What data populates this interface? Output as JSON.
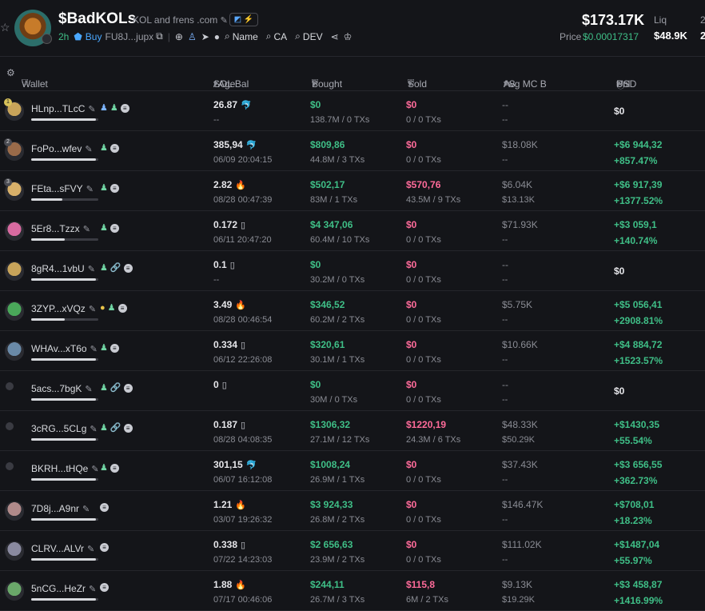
{
  "token": {
    "name": "$BadKOLs",
    "description": "KOL and frens .com",
    "age": "2h",
    "buy_label": "Buy",
    "address": "FU8J...jupx",
    "links": [
      "Name",
      "CA",
      "DEV"
    ],
    "market_cap": "$173.17K",
    "price_label": "Price",
    "price": "$0.00017317",
    "liq_label": "Liq",
    "liq": "$48.9K",
    "next_label": "2",
    "next_val": "2",
    "colors": {
      "positive": "#3fbf87",
      "negative": "#ff6b9a",
      "accent": "#4aa8ff",
      "background": "#141519"
    }
  },
  "columns": {
    "wallet": "Wallet",
    "sol_bal": "SOL Bal",
    "age": "/ Age",
    "bought": "Bought",
    "sold": "Sold",
    "avg_mc": "Avg MC B",
    "avg_mc_s": "/ S",
    "pnl": "Pnl",
    "usd": "USD"
  },
  "rows": [
    {
      "rank": "1",
      "addr": "HLnp...TLcC",
      "sol": "26.87",
      "src": "bonk",
      "date": "--",
      "bought": "$0",
      "bought_sub": "138.7M / 0 TXs",
      "sold": "$0",
      "sold_sub": "0 / 0 TXs",
      "mcb": "--",
      "mcs": "--",
      "pnl": "$0",
      "pct": "",
      "icons": [
        "user-blue",
        "user",
        "coin"
      ],
      "bar": 0.96,
      "avatar": "#c8a45a"
    },
    {
      "rank": "2",
      "addr": "FoPo...wfev",
      "sol": "385,94",
      "src": "gray",
      "date": "06/09 20:04:15",
      "bought": "$809,86",
      "bought_sub": "44.8M / 3 TXs",
      "sold": "$0",
      "sold_sub": "0 / 0 TXs",
      "mcb": "$18.08K",
      "mcs": "--",
      "pnl": "+$6 944,32",
      "pct": "+857.47%",
      "icons": [
        "user",
        "coin"
      ],
      "bar": 0.96,
      "avatar": "#9a6b4a"
    },
    {
      "rank": "3",
      "addr": "FEta...sFVY",
      "sol": "2.82",
      "src": "fire",
      "date": "08/28 00:47:39",
      "bought": "$502,17",
      "bought_sub": "83M / 1 TXs",
      "sold": "$570,76",
      "sold_sub": "43.5M / 9 TXs",
      "mcb": "$6.04K",
      "mcs": "$13.13K",
      "pnl": "+$6 917,39",
      "pct": "+1377.52%",
      "icons": [
        "user",
        "coin"
      ],
      "bar": 0.46,
      "avatar": "#d8b06a"
    },
    {
      "rank": "",
      "addr": "5Er8...Tzzx",
      "sol": "0.172",
      "src": "box",
      "date": "06/11 20:47:20",
      "bought": "$4 347,06",
      "bought_sub": "60.4M / 10 TXs",
      "sold": "$0",
      "sold_sub": "0 / 0 TXs",
      "mcb": "$71.93K",
      "mcs": "--",
      "pnl": "+$3 059,1",
      "pct": "+140.74%",
      "icons": [
        "user",
        "coin"
      ],
      "bar": 0.5,
      "avatar": "#d86aa0"
    },
    {
      "rank": "",
      "addr": "8gR4...1vbU",
      "sol": "0.1",
      "src": "box",
      "date": "--",
      "bought": "$0",
      "bought_sub": "30.2M / 0 TXs",
      "sold": "$0",
      "sold_sub": "0 / 0 TXs",
      "mcb": "--",
      "mcs": "--",
      "pnl": "$0",
      "pct": "",
      "icons": [
        "user",
        "link",
        "coin"
      ],
      "bar": 0.96,
      "avatar": "#c8a45a"
    },
    {
      "rank": "",
      "addr": "3ZYP...xVQz",
      "sol": "3.49",
      "src": "fire",
      "date": "08/28 00:46:54",
      "bought": "$346,52",
      "bought_sub": "60.2M / 2 TXs",
      "sold": "$0",
      "sold_sub": "0 / 0 TXs",
      "mcb": "$5.75K",
      "mcs": "--",
      "pnl": "+$5 056,41",
      "pct": "+2908.81%",
      "icons": [
        "dev",
        "user",
        "coin"
      ],
      "bar": 0.5,
      "avatar": "#4aa85a"
    },
    {
      "rank": "",
      "addr": "WHAv...xT6o",
      "sol": "0.334",
      "src": "box",
      "date": "06/12 22:26:08",
      "bought": "$320,61",
      "bought_sub": "30.1M / 1 TXs",
      "sold": "$0",
      "sold_sub": "0 / 0 TXs",
      "mcb": "$10.66K",
      "mcs": "--",
      "pnl": "+$4 884,72",
      "pct": "+1523.57%",
      "icons": [
        "user",
        "coin"
      ],
      "bar": 0.96,
      "avatar": "#6a8aa8"
    },
    {
      "rank": "",
      "addr": "5acs...7bgK",
      "sol": "0",
      "src": "box",
      "date": "",
      "bought": "$0",
      "bought_sub": "30M / 0 TXs",
      "sold": "$0",
      "sold_sub": "0 / 0 TXs",
      "mcb": "--",
      "mcs": "--",
      "pnl": "$0",
      "pct": "",
      "icons": [
        "user",
        "link",
        "coin"
      ],
      "bar": 0.96,
      "avatar": "small"
    },
    {
      "rank": "",
      "addr": "3cRG...5CLg",
      "sol": "0.187",
      "src": "box",
      "date": "08/28 04:08:35",
      "bought": "$1306,32",
      "bought_sub": "27.1M / 12 TXs",
      "sold": "$1220,19",
      "sold_sub": "24.3M / 6 TXs",
      "mcb": "$48.33K",
      "mcs": "$50.29K",
      "pnl": "+$1430,35",
      "pct": "+55.54%",
      "icons": [
        "user",
        "link",
        "coin"
      ],
      "bar": 0.96,
      "avatar": "small"
    },
    {
      "rank": "",
      "addr": "BKRH...tHQe",
      "sol": "301,15",
      "src": "gray",
      "date": "06/07 16:12:08",
      "bought": "$1008,24",
      "bought_sub": "26.9M / 1 TXs",
      "sold": "$0",
      "sold_sub": "0 / 0 TXs",
      "mcb": "$37.43K",
      "mcs": "--",
      "pnl": "+$3 656,55",
      "pct": "+362.73%",
      "icons": [
        "user",
        "coin"
      ],
      "bar": 0.96,
      "avatar": "small"
    },
    {
      "rank": "",
      "addr": "7D8j...A9nr",
      "sol": "1.21",
      "src": "fire",
      "date": "03/07 19:26:32",
      "bought": "$3 924,33",
      "bought_sub": "26.8M / 2 TXs",
      "sold": "$0",
      "sold_sub": "0 / 0 TXs",
      "mcb": "$146.47K",
      "mcs": "--",
      "pnl": "+$708,01",
      "pct": "+18.23%",
      "icons": [
        "coin"
      ],
      "bar": 0.96,
      "avatar": "#b08a8a"
    },
    {
      "rank": "",
      "addr": "CLRV...ALVr",
      "sol": "0.338",
      "src": "box",
      "date": "07/22 14:23:03",
      "bought": "$2 656,63",
      "bought_sub": "23.9M / 2 TXs",
      "sold": "$0",
      "sold_sub": "0 / 0 TXs",
      "mcb": "$111.02K",
      "mcs": "--",
      "pnl": "+$1487,04",
      "pct": "+55.97%",
      "icons": [
        "coin"
      ],
      "bar": 0.96,
      "avatar": "#8a8aa0"
    },
    {
      "rank": "",
      "addr": "5nCG...HeZr",
      "sol": "1.88",
      "src": "fire",
      "date": "07/17 00:46:06",
      "bought": "$244,11",
      "bought_sub": "26.7M / 3 TXs",
      "sold": "$115,8",
      "sold_sub": "6M / 2 TXs",
      "mcb": "$9.13K",
      "mcs": "$19.29K",
      "pnl": "+$3 458,87",
      "pct": "+1416.99%",
      "icons": [
        "coin"
      ],
      "bar": 0.96,
      "avatar": "#6aa86a"
    }
  ]
}
